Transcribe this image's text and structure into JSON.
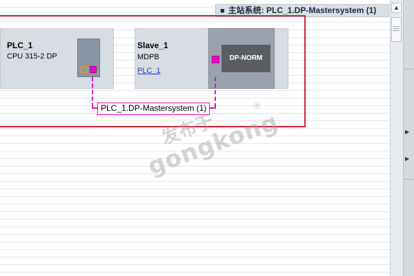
{
  "master_banner": {
    "pin": "■",
    "label": "主站系统: PLC_1.DP-Mastersystem (1)"
  },
  "plc": {
    "name": "PLC_1",
    "type": "CPU 315-2 DP"
  },
  "slave": {
    "name": "Slave_1",
    "type": "MDPB",
    "link": "PLC_1",
    "module_label": "DP-NORM"
  },
  "bus": {
    "label": "PLC_1.DP-Mastersystem (1)"
  },
  "watermark": {
    "cn": "发布于",
    "en": "gongkong",
    "reg": "®"
  },
  "scrollbar": {
    "up_arrow": "▲"
  },
  "right_strip": {
    "arrow1": "▶",
    "arrow2": "▶"
  },
  "colors": {
    "frame": "#d51f36",
    "bus": "#f200c8",
    "device": "#d8dce3"
  }
}
